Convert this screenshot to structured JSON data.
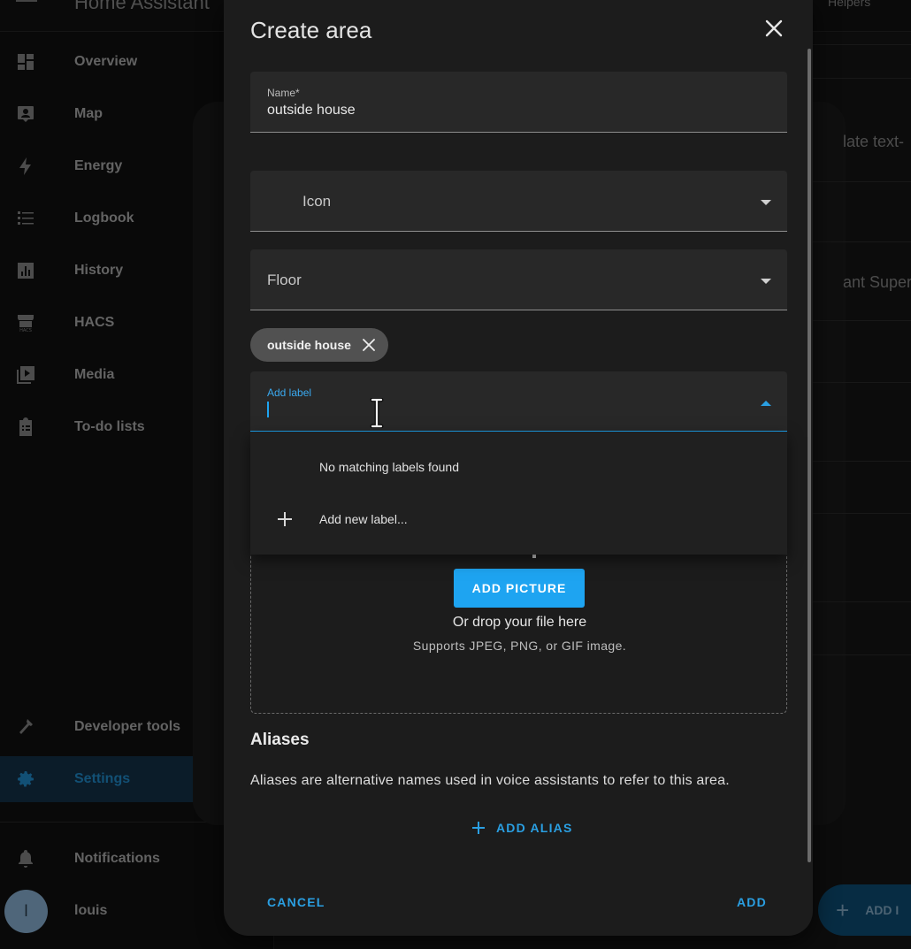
{
  "app": {
    "title": "Home Assistant",
    "header_right": "Helpers"
  },
  "sidebar": {
    "items": [
      {
        "label": "Overview",
        "icon": "view-dashboard-icon"
      },
      {
        "label": "Map",
        "icon": "map-icon"
      },
      {
        "label": "Energy",
        "icon": "lightning-icon"
      },
      {
        "label": "Logbook",
        "icon": "logbook-icon"
      },
      {
        "label": "History",
        "icon": "chart-icon"
      },
      {
        "label": "HACS",
        "icon": "hacs-icon"
      },
      {
        "label": "Media",
        "icon": "media-icon"
      },
      {
        "label": "To-do lists",
        "icon": "clipboard-list-icon"
      }
    ],
    "developer_tools": "Developer tools",
    "settings": "Settings",
    "notifications": "Notifications",
    "user": {
      "name": "louis",
      "initial": "l"
    }
  },
  "background": {
    "peek_1": "late text-",
    "peek_2": "ant Super",
    "fab_label": "ADD I"
  },
  "dialog": {
    "title": "Create area",
    "name_field": {
      "label": "Name*",
      "value": "outside house"
    },
    "icon_field": {
      "placeholder": "Icon"
    },
    "floor_field": {
      "placeholder": "Floor"
    },
    "chip": {
      "label": "outside house"
    },
    "label_field": {
      "label": "Add label",
      "value": ""
    },
    "dropdown": {
      "no_match": "No matching labels found",
      "add_new": "Add new label..."
    },
    "picture": {
      "button": "ADD PICTURE",
      "drop_text": "Or drop your file here",
      "supports": "Supports JPEG, PNG, or GIF image."
    },
    "aliases": {
      "title": "Aliases",
      "description": "Aliases are alternative names used in voice assistants to refer to this area.",
      "add_button": "ADD ALIAS"
    },
    "actions": {
      "cancel": "CANCEL",
      "add": "ADD"
    }
  },
  "colors": {
    "accent": "#1ea4f1",
    "surface": "#1c1c1c",
    "field": "#282828"
  }
}
